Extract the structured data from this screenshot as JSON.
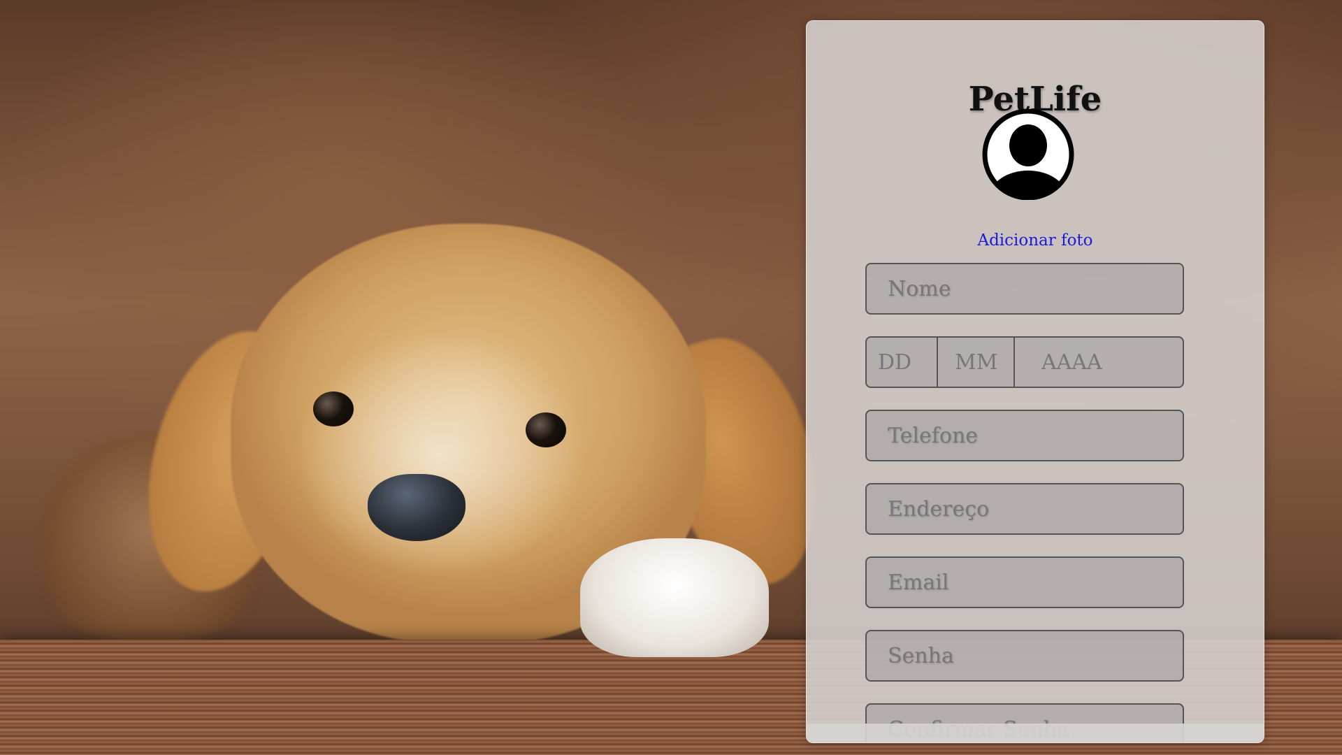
{
  "app": {
    "title": "PetLife"
  },
  "profile": {
    "avatar_icon": "user-avatar-icon",
    "add_photo_label": "Adicionar foto"
  },
  "form": {
    "name_placeholder": "Nome",
    "birth_day_placeholder": "DD",
    "birth_month_placeholder": "MM",
    "birth_year_placeholder": "AAAA",
    "phone_placeholder": "Telefone",
    "address_placeholder": "Endereço",
    "email_placeholder": "Email",
    "password_placeholder": "Senha",
    "confirm_password_placeholder": "Confirmar Senha"
  },
  "colors": {
    "link": "#1a1adc",
    "panel": "#d6d2d0",
    "field_border": "#555555"
  }
}
